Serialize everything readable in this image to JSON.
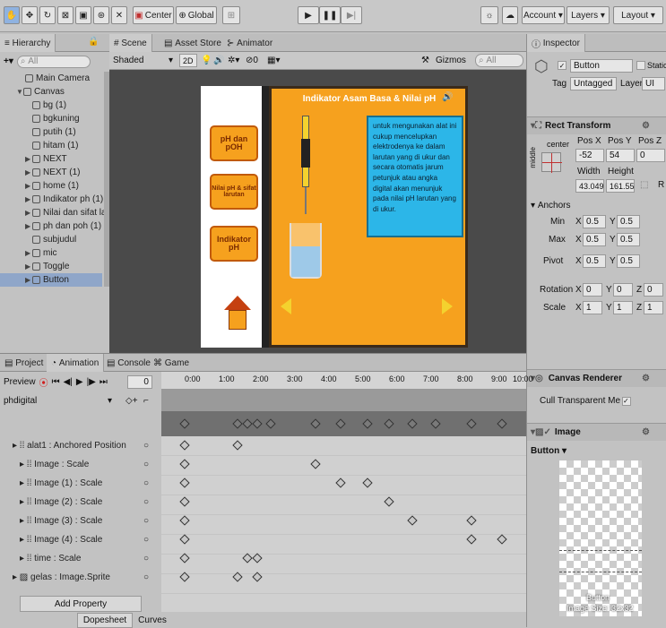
{
  "toolbar": {
    "center_label": "Center",
    "global_label": "Global",
    "account_label": "Account",
    "layers_label": "Layers",
    "layout_label": "Layout"
  },
  "hierarchy": {
    "title": "Hierarchy",
    "search": "All",
    "items": [
      "Main Camera",
      "Canvas",
      "bg (1)",
      "bgkuning",
      "putih (1)",
      "hitam (1)",
      "NEXT",
      "NEXT (1)",
      "home (1)",
      "Indikator ph (1)",
      "Nilai dan sifat la",
      "ph dan poh (1)",
      "subjudul",
      "mic",
      "Toggle",
      "Button"
    ]
  },
  "scene": {
    "tabs": [
      "Scene",
      "Asset Store",
      "Animator"
    ],
    "shading": "Shaded",
    "mode_2d": "2D",
    "gizmos": "Gizmos",
    "search": "All"
  },
  "game_view": {
    "title": "Indikator Asam Basa & Nilai pH",
    "btn1": "pH dan pOH",
    "btn2": "Nilai pH & sifat larutan",
    "btn3": "Indikator pH",
    "info": "untuk mengunakan alat ini cukup mencelupkan elektrodenya ke dalam larutan yang di ukur dan secara otomatis jarum petunjuk atau angka digital akan menunjuk pada nilai pH larutan yang di ukur."
  },
  "inspector": {
    "title": "Inspector",
    "object_name": "Button",
    "static_label": "Static",
    "tag_label": "Tag",
    "tag_value": "Untagged",
    "layer_label": "Layer",
    "layer_value": "UI",
    "rect_title": "Rect Transform",
    "anchor_mode": "center",
    "side_mode": "middle",
    "pos_x_label": "Pos X",
    "pos_y_label": "Pos Y",
    "pos_z_label": "Pos Z",
    "pos_x": "-52",
    "pos_y": "54",
    "pos_z": "0",
    "width_label": "Width",
    "height_label": "Height",
    "width": "43.049",
    "height": "161.55",
    "r_label": "R",
    "anchors_label": "Anchors",
    "min_label": "Min",
    "max_label": "Max",
    "pivot_label": "Pivot",
    "min_x": "0.5",
    "min_y": "0.5",
    "max_x": "0.5",
    "max_y": "0.5",
    "pivot_x": "0.5",
    "pivot_y": "0.5",
    "rotation_label": "Rotation",
    "rot_x": "0",
    "rot_y": "0",
    "rot_z": "0",
    "scale_label": "Scale",
    "scale_x": "1",
    "scale_y": "1",
    "scale_z": "1",
    "canvas_renderer": "Canvas Renderer",
    "cull_label": "Cull Transparent Me",
    "image_title": "Image",
    "preview_label": "Button",
    "preview_name": "Button",
    "preview_size": "Image Size: 32x32"
  },
  "bottom": {
    "tabs": [
      "Project",
      "Animation",
      "Console",
      "Game"
    ],
    "preview_label": "Preview",
    "frame": "0",
    "clip": "phdigital",
    "ticks": [
      "0:00",
      "1:00",
      "2:00",
      "3:00",
      "4:00",
      "5:00",
      "6:00",
      "7:00",
      "8:00",
      "9:00",
      "10:00"
    ],
    "properties": [
      "alat1 : Anchored Position",
      "Image : Scale",
      "Image (1) : Scale",
      "Image (2) : Scale",
      "Image (3) : Scale",
      "Image (4) : Scale",
      "time : Scale",
      "gelas : Image.Sprite"
    ],
    "add_property": "Add Property",
    "dopesheet": "Dopesheet",
    "curves": "Curves"
  },
  "colors": {
    "orange": "#f6a11e",
    "selection": "#8fa6c9",
    "info_blue": "#2cb6e8",
    "dark": "#3a3a3a"
  }
}
